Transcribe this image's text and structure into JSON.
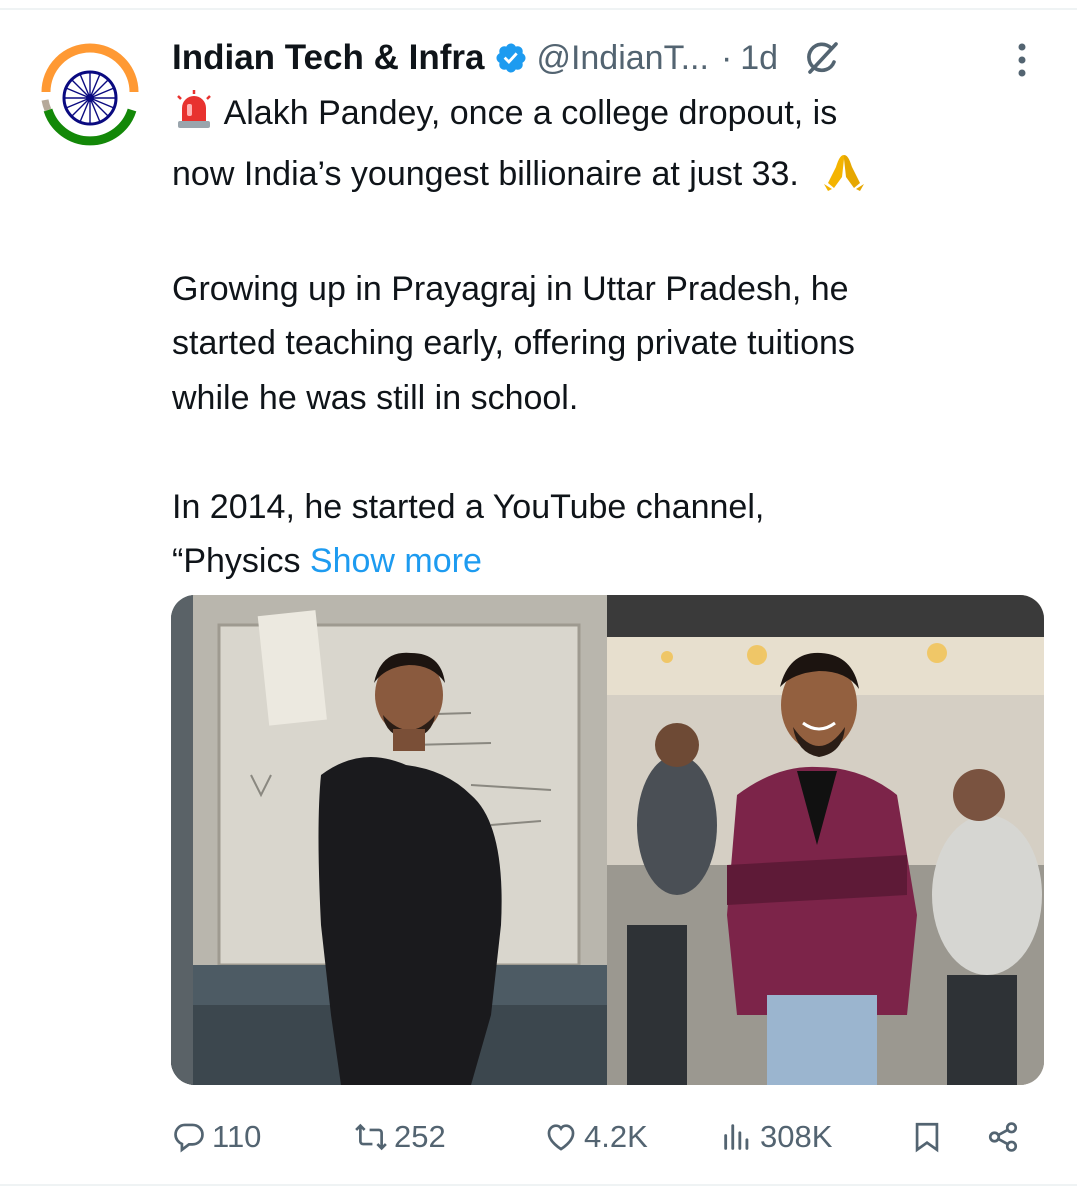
{
  "tweet": {
    "author_name": "Indian Tech & Infra",
    "handle": "@IndianT...",
    "separator": "·",
    "time": "1d",
    "lines": [
      "Alakh Pandey, once a college dropout, is",
      "now India’s youngest billionaire at just 33."
    ],
    "para2": [
      "Growing up in Prayagraj in Uttar Pradesh, he",
      "started teaching early, offering private tuitions",
      "while he was still in school."
    ],
    "para3_line1": "In 2014, he started a YouTube channel,",
    "para3_line2": "“Physics",
    "show_more": "Show more",
    "icons": {
      "verified": "verified-badge-icon",
      "grok": "grok-icon",
      "more": "more-vertical-icon",
      "siren": "police-light-emoji",
      "pray": "folded-hands-emoji"
    }
  },
  "actions": {
    "replies": "110",
    "reposts": "252",
    "likes": "4.2K",
    "views": "308K"
  },
  "colors": {
    "link": "#1d9bf0",
    "secondary_text": "#536471",
    "verified": "#1d9bf0",
    "saffron": "#ff9933",
    "green": "#138808",
    "chakra": "#000080"
  }
}
